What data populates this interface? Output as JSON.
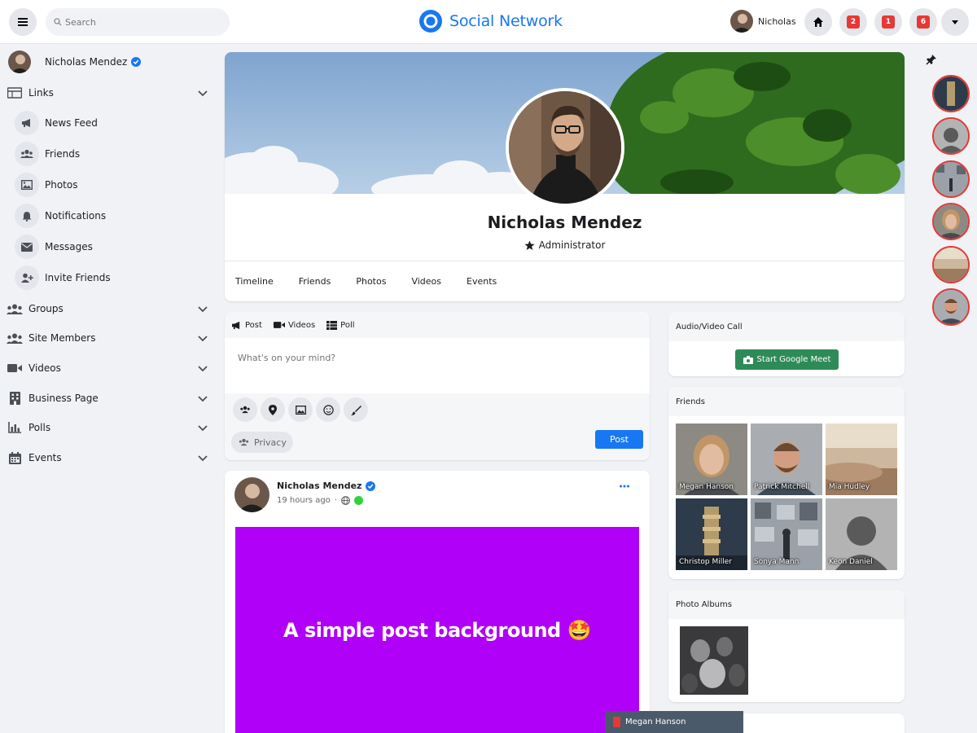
{
  "header": {
    "search_placeholder": "Search",
    "brand_name": "Social Network",
    "user_name": "Nicholas",
    "icons": [
      "menu-icon",
      "search-icon",
      "brand-logo-icon",
      "home-icon",
      "notification-icon",
      "notification-icon",
      "notification-icon",
      "caret-down-icon"
    ]
  },
  "sidebar": {
    "profile_name": "Nicholas Mendez",
    "links_label": "Links",
    "sub_items": [
      {
        "label": "News Feed",
        "icon": "megaphone-icon"
      },
      {
        "label": "Friends",
        "icon": "friends-icon"
      },
      {
        "label": "Photos",
        "icon": "photo-icon"
      },
      {
        "label": "Notifications",
        "icon": "bell-icon"
      },
      {
        "label": "Messages",
        "icon": "envelope-icon"
      },
      {
        "label": "Invite Friends",
        "icon": "user-plus-icon"
      }
    ],
    "sections": [
      {
        "label": "Groups",
        "icon": "groups-icon"
      },
      {
        "label": "Site Members",
        "icon": "members-icon"
      },
      {
        "label": "Videos",
        "icon": "video-icon"
      },
      {
        "label": "Business Page",
        "icon": "building-icon"
      },
      {
        "label": "Polls",
        "icon": "chart-icon"
      },
      {
        "label": "Events",
        "icon": "calendar-icon"
      }
    ]
  },
  "profile": {
    "name": "Nicholas Mendez",
    "role": "Administrator",
    "tabs": [
      "Timeline",
      "Friends",
      "Photos",
      "Videos",
      "Events"
    ]
  },
  "composer": {
    "tabs": [
      "Post",
      "Videos",
      "Poll"
    ],
    "placeholder": "What's on your mind?",
    "privacy_label": "Privacy",
    "post_label": "Post"
  },
  "post": {
    "author": "Nicholas Mendez",
    "time": "19 hours ago",
    "background_text": "A simple post background 🤩",
    "background_color": "#b000f8"
  },
  "widgets": {
    "call_title": "Audio/Video Call",
    "meet_label": "Start Google Meet",
    "friends_title": "Friends",
    "friends": [
      "Megan Hanson",
      "Patrick Mitchell",
      "Mia Hudley",
      "Christop Miller",
      "Sonya Mann",
      "Keon Daniel"
    ],
    "albums_title": "Photo Albums"
  },
  "chat": {
    "name": "Megan Hanson"
  },
  "colors": {
    "accent": "#1877f2",
    "meet_green": "#2e8b57",
    "badge_red": "#e53935",
    "online_green": "#31d23a"
  }
}
